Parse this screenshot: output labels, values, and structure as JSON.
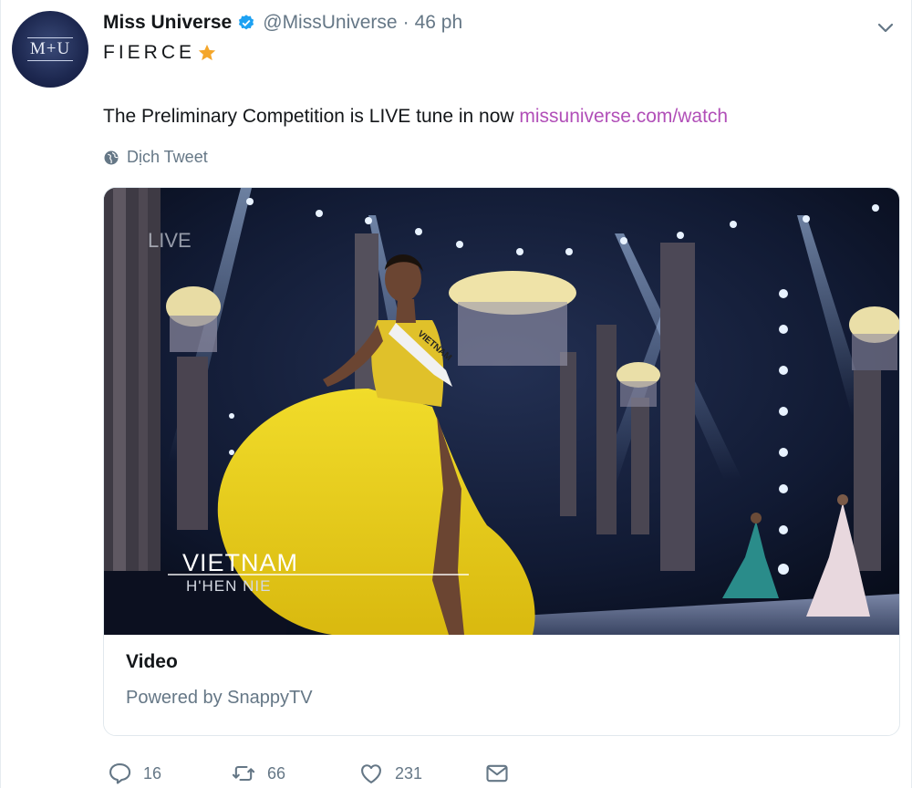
{
  "tweet": {
    "avatar_text": "M+U",
    "author_name": "Miss Universe",
    "handle": "@MissUniverse",
    "separator": "·",
    "time": "46 ph",
    "line1": "FIERCE",
    "body": "The Preliminary Competition is LIVE tune in now ",
    "link": "missuniverse.com/watch",
    "translate_label": "Dịch Tweet"
  },
  "media": {
    "live_label": "LIVE",
    "caption_country": "VIETNAM",
    "caption_name": "H'HEN NIE",
    "sash_text": "VIETNAM"
  },
  "card": {
    "title": "Video",
    "subtitle": "Powered by SnappyTV"
  },
  "actions": {
    "reply_count": "16",
    "retweet_count": "66",
    "like_count": "231"
  },
  "colors": {
    "link": "#b14fb8",
    "verified": "#1da1f2",
    "muted": "#657786",
    "star": "#f4a62a"
  }
}
